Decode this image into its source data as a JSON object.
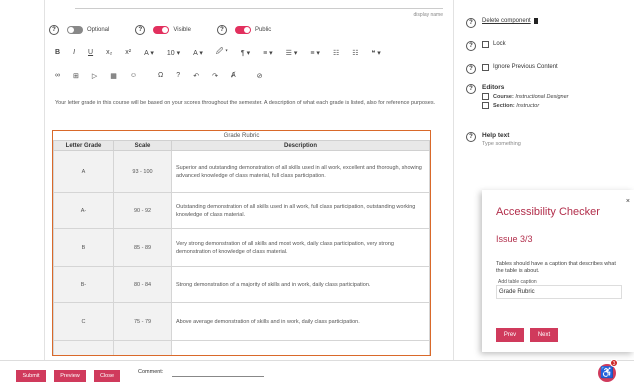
{
  "editor": {
    "display_name_label": "display name",
    "toggles": [
      {
        "label": "Optional",
        "on": false
      },
      {
        "label": "Visible",
        "on": true
      },
      {
        "label": "Public",
        "on": true
      }
    ],
    "toolbar_row1": [
      "B",
      "I",
      "U",
      "x₂",
      "x²",
      "A ▾",
      "10 ▾",
      "A ▾",
      "🖉 ▾",
      "¶ ▾",
      "≡ ▾",
      "☰ ▾",
      "≡ ▾",
      "☷",
      "☷",
      "❝ ▾"
    ],
    "toolbar_row2": [
      "∞",
      "⊞",
      "▷",
      "▦",
      "☺",
      "Ω",
      "?",
      "↶",
      "↷",
      "Ⱥ",
      "⊘"
    ],
    "body_text": "Your letter grade in this course will be based on your scores throughout the semester. A description of what each grade is listed, also for reference purposes.",
    "table": {
      "caption": "Grade Rubric",
      "headers": [
        "Letter Grade",
        "Scale",
        "Description"
      ],
      "rows": [
        {
          "grade": "A",
          "scale": "93 - 100",
          "desc": "Superior and outstanding demonstration of all skills used in all work, excellent and thorough, showing advanced knowledge of class material, full class participation."
        },
        {
          "grade": "A-",
          "scale": "90 - 92",
          "desc": "Outstanding demonstration of all skills used in all work, full class participation, outstanding working knowledge of class material."
        },
        {
          "grade": "B",
          "scale": "85 - 89",
          "desc": "Very strong demonstration of all skills and most work, daily class participation, very strong demonstration of knowledge of class material."
        },
        {
          "grade": "B-",
          "scale": "80 - 84",
          "desc": "Strong demonstration of a majority of skills and in work, daily class participation."
        },
        {
          "grade": "C",
          "scale": "75 - 79",
          "desc": "Above average demonstration of skills and in work, daily class participation."
        },
        {
          "grade": "",
          "scale": "",
          "desc": ""
        }
      ]
    }
  },
  "sidebar": {
    "delete_link": "Delete component",
    "lock": "Lock",
    "ignore_previous": "Ignore Previous Content",
    "editors_title": "Editors",
    "course_label": "Course:",
    "course_value": "Instructional Designer",
    "section_label": "Section:",
    "section_value": "Instructor",
    "help_title": "Help text",
    "help_placeholder": "Type something"
  },
  "accessibility_checker": {
    "title": "Accessibility Checker",
    "issue": "Issue 3/3",
    "message": "Tables should have a caption that describes what the table is about.",
    "field_label": "Add table caption",
    "field_value": "Grade Rubric",
    "prev_label": "Prev",
    "next_label": "Next",
    "close_glyph": "×"
  },
  "bottom_bar": {
    "submit": "Submit",
    "preview": "Preview",
    "close": "Close",
    "comment_label": "Comment:"
  },
  "fab": {
    "badge": "3"
  },
  "colors": {
    "accent": "#d03a5c",
    "table_border": "#d9692a"
  }
}
